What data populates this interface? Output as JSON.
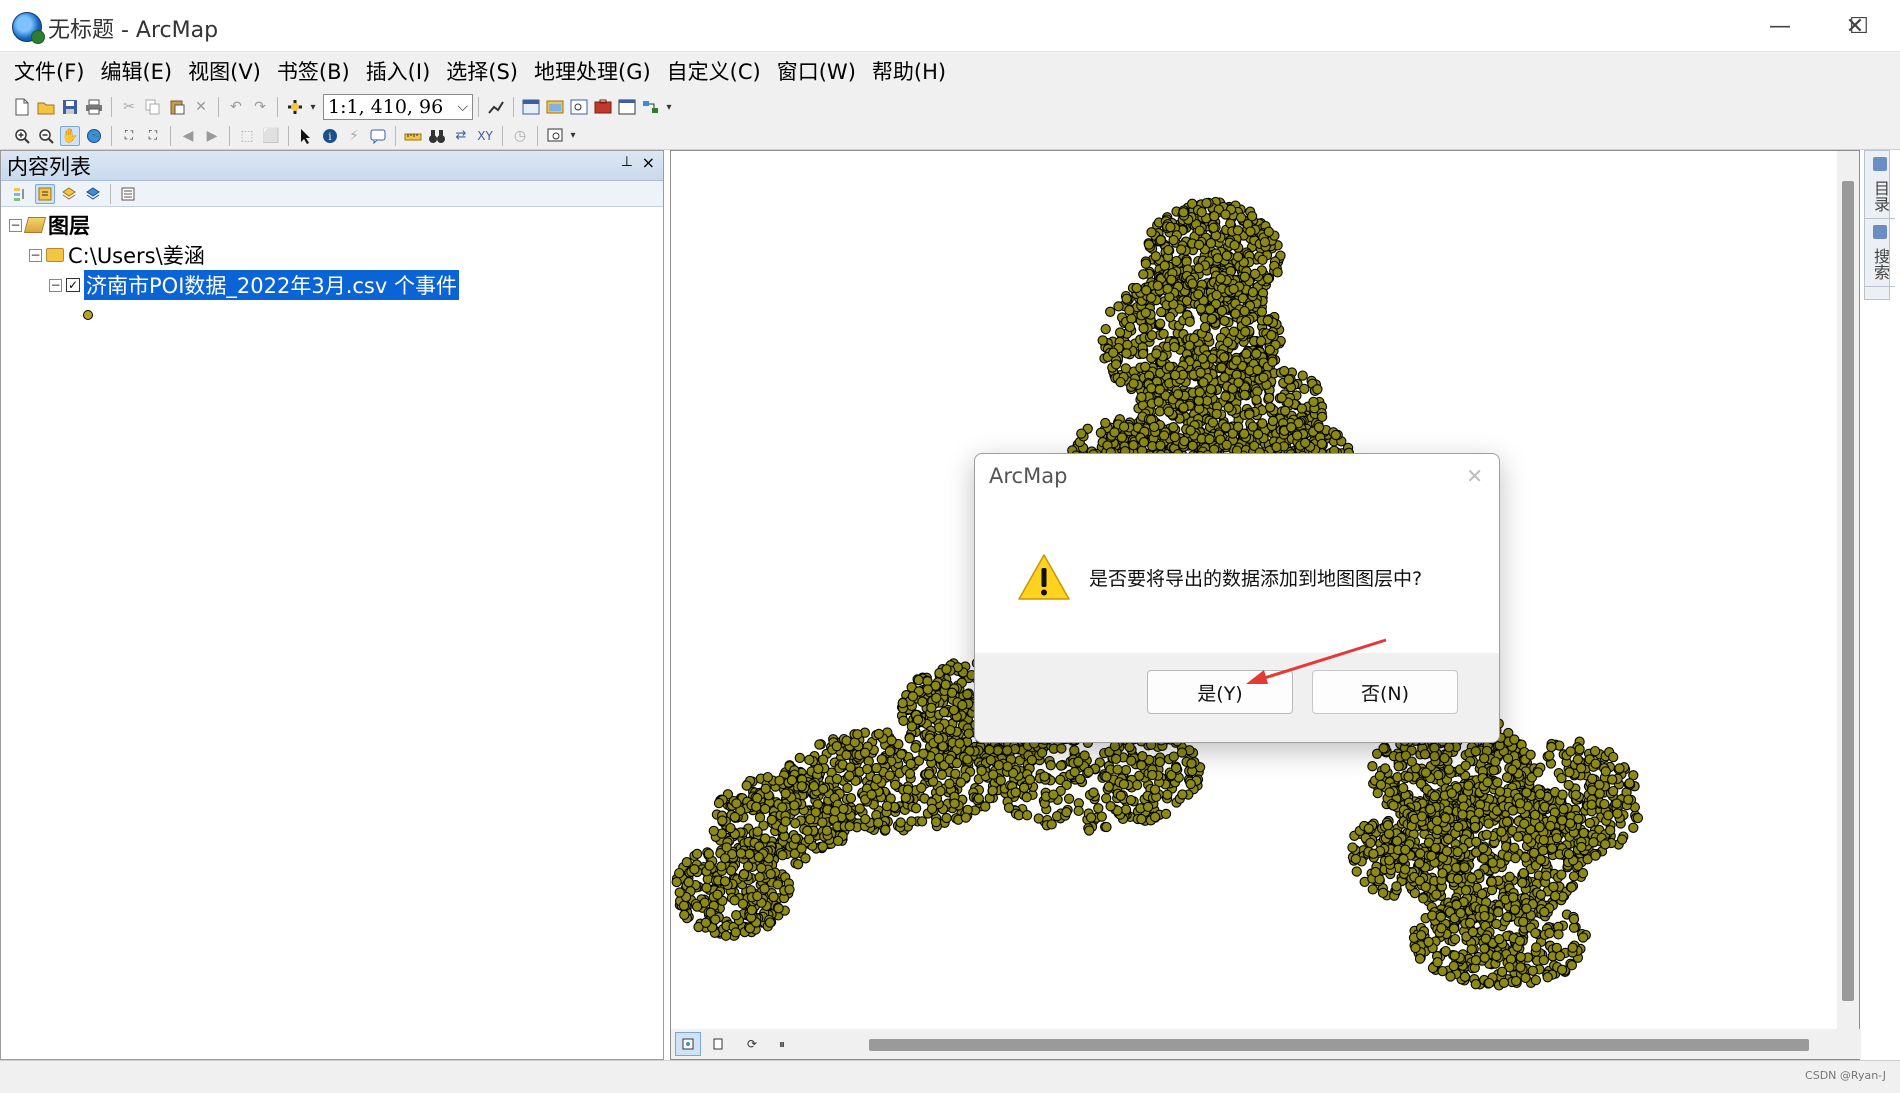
{
  "window": {
    "title": "无标题 - ArcMap",
    "minimize_glyph": "—",
    "maximize_glyph": "☐",
    "close_glyph": "✕"
  },
  "menu": [
    {
      "label": "文件(F)"
    },
    {
      "label": "编辑(E)"
    },
    {
      "label": "视图(V)"
    },
    {
      "label": "书签(B)"
    },
    {
      "label": "插入(I)"
    },
    {
      "label": "选择(S)"
    },
    {
      "label": "地理处理(G)"
    },
    {
      "label": "自定义(C)"
    },
    {
      "label": "窗口(W)"
    },
    {
      "label": "帮助(H)"
    }
  ],
  "toolbar": {
    "scale_value": "1:1, 410, 96",
    "scale_dropdown_glyph": "⌵"
  },
  "toc": {
    "title": "内容列表",
    "pin_glyph": "⊥",
    "close_glyph": "×",
    "root_label": "图层",
    "folder_label": "C:\\Users\\姜涵",
    "layer_label": "济南市POI数据_2022年3月.csv 个事件",
    "layer_checked": true,
    "symbol_color": "#b5a522"
  },
  "map": {
    "point_fill": "#8c8a14",
    "point_stroke": "#000000",
    "scrollbar_color": "#9a9a9a"
  },
  "side_tabs": [
    {
      "label": "目录",
      "icon": "catalog-icon"
    },
    {
      "label": "搜索",
      "icon": "search-icon"
    }
  ],
  "dialog": {
    "title": "ArcMap",
    "close_glyph": "✕",
    "message": "是否要将导出的数据添加到地图图层中?",
    "yes_label": "是(Y)",
    "no_label": "否(N)",
    "icon": "warning-icon",
    "annotation_arrow_color": "#e53935"
  },
  "status": {
    "watermark": "CSDN @Ryan-J"
  }
}
